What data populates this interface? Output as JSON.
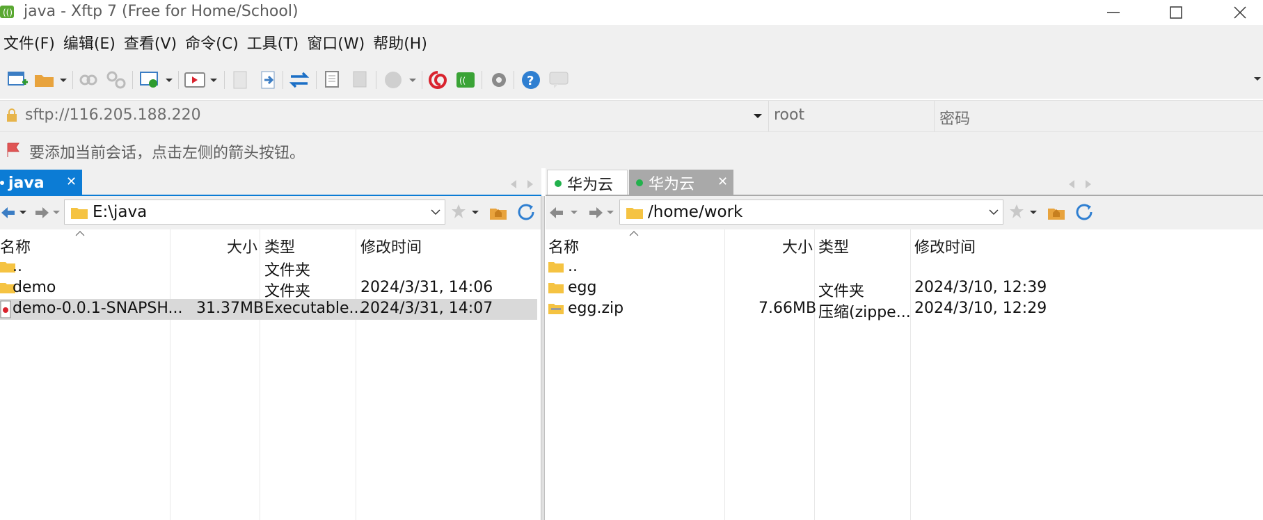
{
  "window": {
    "title": "java - Xftp 7 (Free for Home/School)"
  },
  "menu": [
    "文件(F)",
    "编辑(E)",
    "查看(V)",
    "命令(C)",
    "工具(T)",
    "窗口(W)",
    "帮助(H)"
  ],
  "address": {
    "host": "sftp://116.205.188.220",
    "user_placeholder": "root",
    "password_placeholder": "密码"
  },
  "hint": "要添加当前会话，点击左侧的箭头按钮。",
  "left_pane": {
    "tab": "java",
    "path": "E:\\java",
    "columns": {
      "name": "名称",
      "size": "大小",
      "type": "类型",
      "modified": "修改时间"
    },
    "files": [
      {
        "name": "..",
        "size": "",
        "type": "文件夹",
        "modified": "",
        "icon": "folder-icon"
      },
      {
        "name": "demo",
        "size": "",
        "type": "文件夹",
        "modified": "2024/3/31, 14:06",
        "icon": "folder-icon"
      },
      {
        "name": "demo-0.0.1-SNAPSH...",
        "size": "31.37MB",
        "type": "Executable...",
        "modified": "2024/3/31, 14:07",
        "icon": "jar-file-icon",
        "selected": true
      }
    ]
  },
  "right_pane": {
    "tabs": [
      "华为云",
      "华为云"
    ],
    "path": "/home/work",
    "columns": {
      "name": "名称",
      "size": "大小",
      "type": "类型",
      "modified": "修改时间"
    },
    "files": [
      {
        "name": "..",
        "size": "",
        "type": "",
        "modified": "",
        "icon": "folder-icon"
      },
      {
        "name": "egg",
        "size": "",
        "type": "文件夹",
        "modified": "2024/3/10, 12:39",
        "icon": "folder-icon"
      },
      {
        "name": "egg.zip",
        "size": "7.66MB",
        "type": "压缩(zippe...",
        "modified": "2024/3/10, 12:29",
        "icon": "zip-folder-icon"
      }
    ]
  },
  "colors": {
    "accent": "#0c7cd5",
    "selected_row": "#d9d9d9",
    "folder": "#f5c342",
    "status_dot": "#22b14c"
  }
}
